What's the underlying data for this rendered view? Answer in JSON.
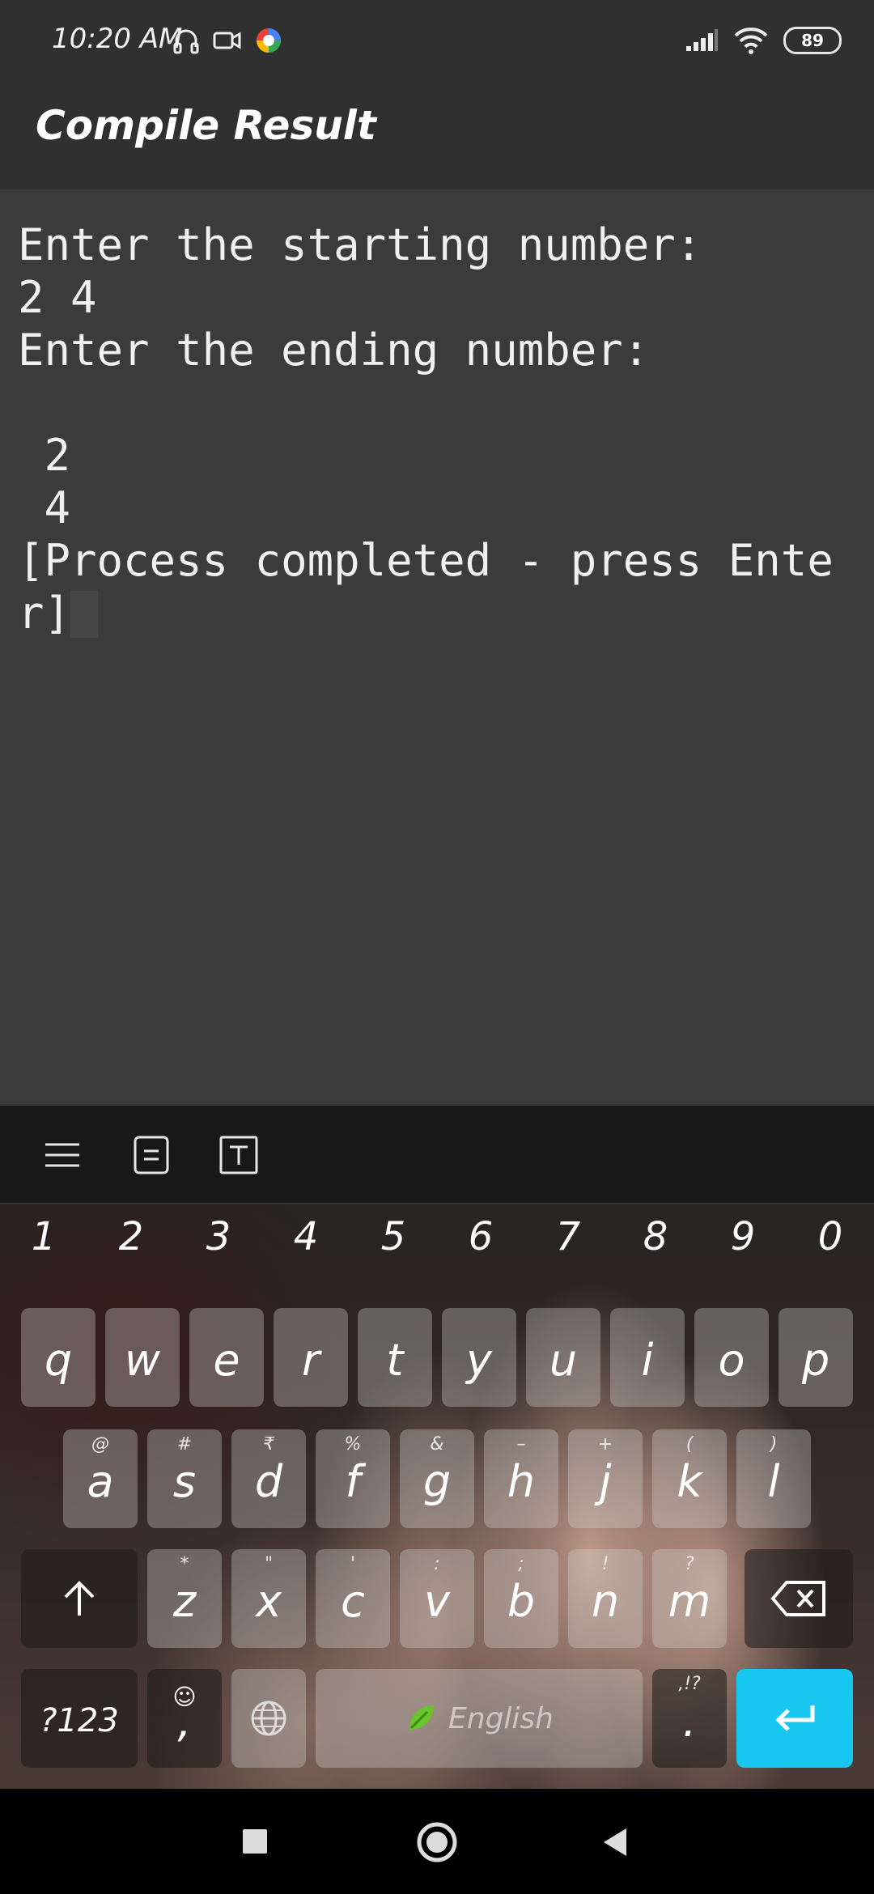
{
  "status_bar": {
    "time": "10:20 AM",
    "left_icons": [
      "headphones-icon",
      "video-camera-icon",
      "google-app-icon"
    ],
    "right_icons": [
      "signal-icon",
      "wifi-icon",
      "battery-icon"
    ],
    "battery": "89"
  },
  "app_bar": {
    "title": "Compile Result"
  },
  "console": {
    "lines": [
      "Enter the starting number:",
      "2 4",
      "Enter the ending number:",
      "",
      " 2",
      " 4",
      "[Process completed - press Ente",
      "r]"
    ]
  },
  "keyboard": {
    "toolbar_icons": [
      "menu-icon",
      "clipboard-icon",
      "text-format-icon"
    ],
    "numbers": [
      "1",
      "2",
      "3",
      "4",
      "5",
      "6",
      "7",
      "8",
      "9",
      "0"
    ],
    "row1": [
      "q",
      "w",
      "e",
      "r",
      "t",
      "y",
      "u",
      "i",
      "o",
      "p"
    ],
    "row2": [
      {
        "key": "a",
        "hint": "@"
      },
      {
        "key": "s",
        "hint": "#"
      },
      {
        "key": "d",
        "hint": "₹"
      },
      {
        "key": "f",
        "hint": "%"
      },
      {
        "key": "g",
        "hint": "&"
      },
      {
        "key": "h",
        "hint": "–"
      },
      {
        "key": "j",
        "hint": "+"
      },
      {
        "key": "k",
        "hint": "("
      },
      {
        "key": "l",
        "hint": ")"
      }
    ],
    "row3": [
      {
        "key": "z",
        "hint": "*"
      },
      {
        "key": "x",
        "hint": "\""
      },
      {
        "key": "c",
        "hint": "'"
      },
      {
        "key": "v",
        "hint": ":"
      },
      {
        "key": "b",
        "hint": ";"
      },
      {
        "key": "n",
        "hint": "!"
      },
      {
        "key": "m",
        "hint": "?"
      }
    ],
    "symbols_key": "?123",
    "comma_key": ",",
    "period_key": ".",
    "period_hint": ",!?",
    "space_label": "English",
    "accent_color": "#17c7f0"
  },
  "nav_bar": {
    "icons": [
      "recents-square-icon",
      "home-circle-icon",
      "back-triangle-icon"
    ]
  }
}
